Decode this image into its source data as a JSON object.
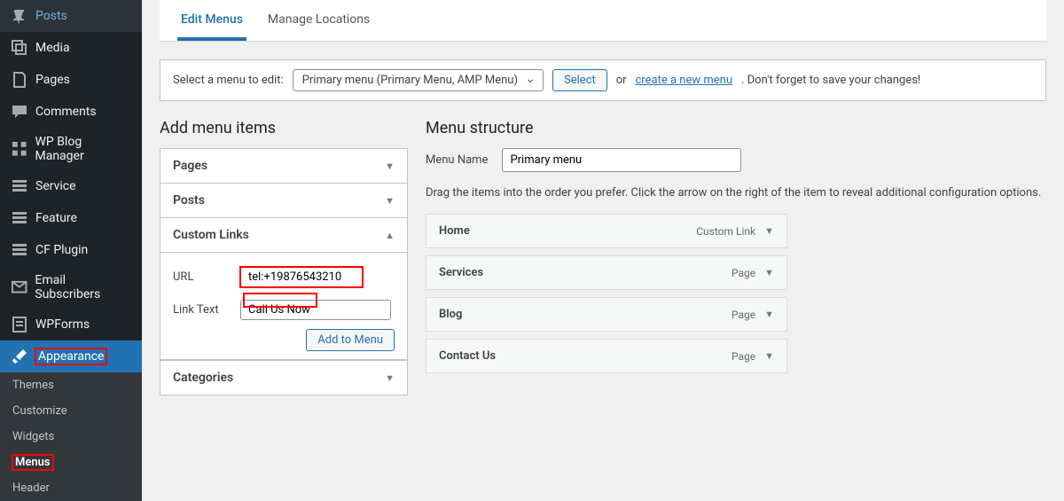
{
  "sidebar": {
    "items": [
      {
        "label": "Posts"
      },
      {
        "label": "Media"
      },
      {
        "label": "Pages"
      },
      {
        "label": "Comments"
      },
      {
        "label": "WP Blog Manager"
      },
      {
        "label": "Service"
      },
      {
        "label": "Feature"
      },
      {
        "label": "CF Plugin"
      },
      {
        "label": "Email Subscribers"
      },
      {
        "label": "WPForms"
      },
      {
        "label": "Appearance"
      }
    ],
    "sub": [
      "Themes",
      "Customize",
      "Widgets",
      "Menus",
      "Header"
    ]
  },
  "tabs": {
    "edit": "Edit Menus",
    "manage": "Manage Locations"
  },
  "selectRow": {
    "label": "Select a menu to edit:",
    "dropdown": "Primary menu (Primary Menu, AMP Menu)",
    "selectBtn": "Select",
    "or": "or",
    "createLink": "create a new menu",
    "suffix": ". Don't forget to save your changes!"
  },
  "left": {
    "heading": "Add menu items",
    "panels": {
      "pages": "Pages",
      "posts": "Posts",
      "custom": "Custom Links",
      "categories": "Categories"
    },
    "custom": {
      "urlLabel": "URL",
      "urlValue": "tel:+19876543210",
      "textLabel": "Link Text",
      "textValue": "Call Us Now",
      "addBtn": "Add to Menu"
    }
  },
  "right": {
    "heading": "Menu structure",
    "menuNameLabel": "Menu Name",
    "menuNameValue": "Primary menu",
    "hint": "Drag the items into the order you prefer. Click the arrow on the right of the item to reveal additional configuration options.",
    "items": [
      {
        "title": "Home",
        "type": "Custom Link"
      },
      {
        "title": "Services",
        "type": "Page"
      },
      {
        "title": "Blog",
        "type": "Page"
      },
      {
        "title": "Contact Us",
        "type": "Page"
      }
    ]
  }
}
